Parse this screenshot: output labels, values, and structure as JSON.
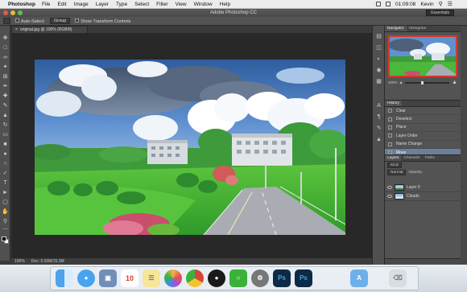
{
  "menubar": {
    "app_name": "Photoshop",
    "items": [
      "File",
      "Edit",
      "Image",
      "Layer",
      "Type",
      "Select",
      "Filter",
      "View",
      "Window",
      "Help"
    ],
    "clock": "01:09:08",
    "user": "Kevin"
  },
  "window": {
    "title": "Adobe Photoshop CC",
    "workspace": "Essentials"
  },
  "options_bar": {
    "auto_select_label": "Auto-Select:",
    "auto_select_value": "Group",
    "show_transform_label": "Show Transform Controls"
  },
  "document": {
    "tab_label": "original.jpg @ 100% (RGB/8)",
    "zoom": "100%",
    "doc_size": "Doc: 5.93M/15.3M"
  },
  "navigator": {
    "tabs": [
      "Navigator",
      "Histogram"
    ],
    "zoom": "100%"
  },
  "history": {
    "tab": "History",
    "items": [
      "Clear",
      "Deselect",
      "Place",
      "Layer Order",
      "Name Change",
      "Move"
    ],
    "active_index": 5
  },
  "layers": {
    "tabs": [
      "Layers",
      "Channels",
      "Paths"
    ],
    "kind_label": "Kind",
    "blend_mode": "Normal",
    "opacity_label": "Opacity:",
    "items": [
      {
        "name": "Layer 0",
        "thumb": "scene"
      },
      {
        "name": "Clouds",
        "thumb": "sky"
      }
    ]
  },
  "dock": {
    "apps": [
      "finder-icon",
      "messages-icon",
      "preview-icon",
      "calendar-icon",
      "notes-icon",
      "photos-icon",
      "chrome-icon",
      "qq-icon",
      "wechat-icon",
      "system-preferences-icon",
      "photoshop-icon",
      "photoshop-icon-2",
      "applications-folder-icon",
      "trash-icon"
    ],
    "calendar_day": "10",
    "ps_label": "Ps",
    "colors": {
      "finder": "#3d8fe0",
      "messages": "#4aa3f0",
      "photos": "#f4b24a",
      "chrome": "#d9443a",
      "qq": "#1a1a1a",
      "wechat": "#3ab23a",
      "photoshop": "#0e2a45",
      "ps_text": "#34a6f5"
    }
  }
}
